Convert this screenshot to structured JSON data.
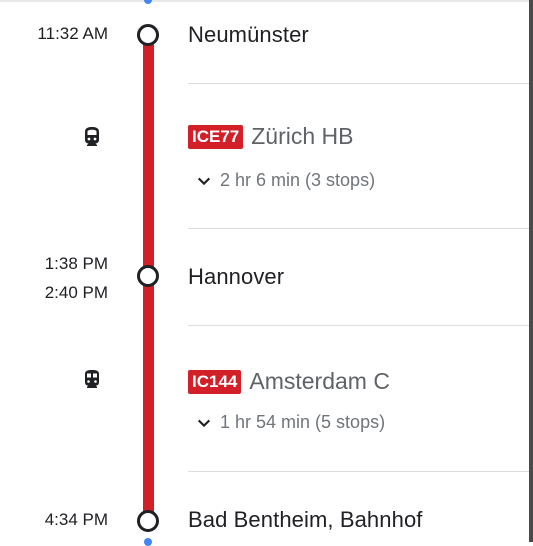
{
  "colors": {
    "route": "#d31f28",
    "badge": "#d31f28",
    "text": "#202124",
    "secondary": "#5f6368",
    "divider": "#dadce0"
  },
  "stops": [
    {
      "times": [
        "11:32 AM"
      ],
      "name": "Neumünster"
    },
    {
      "times": [
        "1:38 PM",
        "2:40 PM"
      ],
      "name": "Hannover"
    },
    {
      "times": [
        "4:34 PM"
      ],
      "name": "Bad Bentheim, Bahnhof"
    }
  ],
  "legs": [
    {
      "icon": "high-speed-train-icon",
      "line": "ICE77",
      "destination": "Zürich HB",
      "duration": "2 hr 6 min (3 stops)"
    },
    {
      "icon": "train-icon",
      "line": "IC144",
      "destination": "Amsterdam C",
      "duration": "1 hr 54 min (5 stops)"
    }
  ]
}
